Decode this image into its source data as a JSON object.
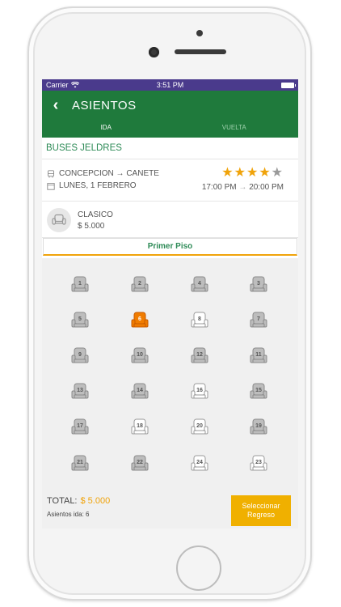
{
  "status_bar": {
    "carrier": "Carrier",
    "time": "3:51 PM"
  },
  "header": {
    "title": "ASIENTOS",
    "tabs": [
      {
        "label": "IDA",
        "active": true
      },
      {
        "label": "VUELTA",
        "active": false
      }
    ]
  },
  "company": "BUSES JELDRES",
  "trip": {
    "route": "CONCEPCION → CANETE",
    "date": "LUNES, 1 FEBRERO",
    "rating": 4,
    "rating_max": 5,
    "depart": "17:00 PM",
    "arrive": "20:00 PM"
  },
  "fare": {
    "class": "CLASICO",
    "price": "$ 5.000"
  },
  "floor_label": "Primer Piso",
  "seats": [
    {
      "number": "1",
      "state": "occupied"
    },
    {
      "number": "2",
      "state": "occupied"
    },
    {
      "number": "4",
      "state": "occupied"
    },
    {
      "number": "3",
      "state": "occupied"
    },
    {
      "number": "5",
      "state": "occupied"
    },
    {
      "number": "6",
      "state": "selected"
    },
    {
      "number": "8",
      "state": "available"
    },
    {
      "number": "7",
      "state": "occupied"
    },
    {
      "number": "9",
      "state": "occupied"
    },
    {
      "number": "10",
      "state": "occupied"
    },
    {
      "number": "12",
      "state": "occupied"
    },
    {
      "number": "11",
      "state": "occupied"
    },
    {
      "number": "13",
      "state": "occupied"
    },
    {
      "number": "14",
      "state": "occupied"
    },
    {
      "number": "16",
      "state": "available"
    },
    {
      "number": "15",
      "state": "occupied"
    },
    {
      "number": "17",
      "state": "occupied"
    },
    {
      "number": "18",
      "state": "available"
    },
    {
      "number": "20",
      "state": "available"
    },
    {
      "number": "19",
      "state": "occupied"
    },
    {
      "number": "21",
      "state": "occupied"
    },
    {
      "number": "22",
      "state": "occupied"
    },
    {
      "number": "24",
      "state": "available"
    },
    {
      "number": "23",
      "state": "available"
    }
  ],
  "footer": {
    "total_label": "TOTAL:",
    "total_amount": "$ 5.000",
    "seats_selected": "Asientos ida: 6",
    "button_label": "Seleccionar Regreso"
  },
  "colors": {
    "header": "#1f7a3c",
    "accent": "#f0a30a",
    "status_bar": "#4a3a8c",
    "seat_occupied": "#bdbdbd",
    "seat_selected": "#f07c00",
    "seat_available": "#ffffff"
  }
}
